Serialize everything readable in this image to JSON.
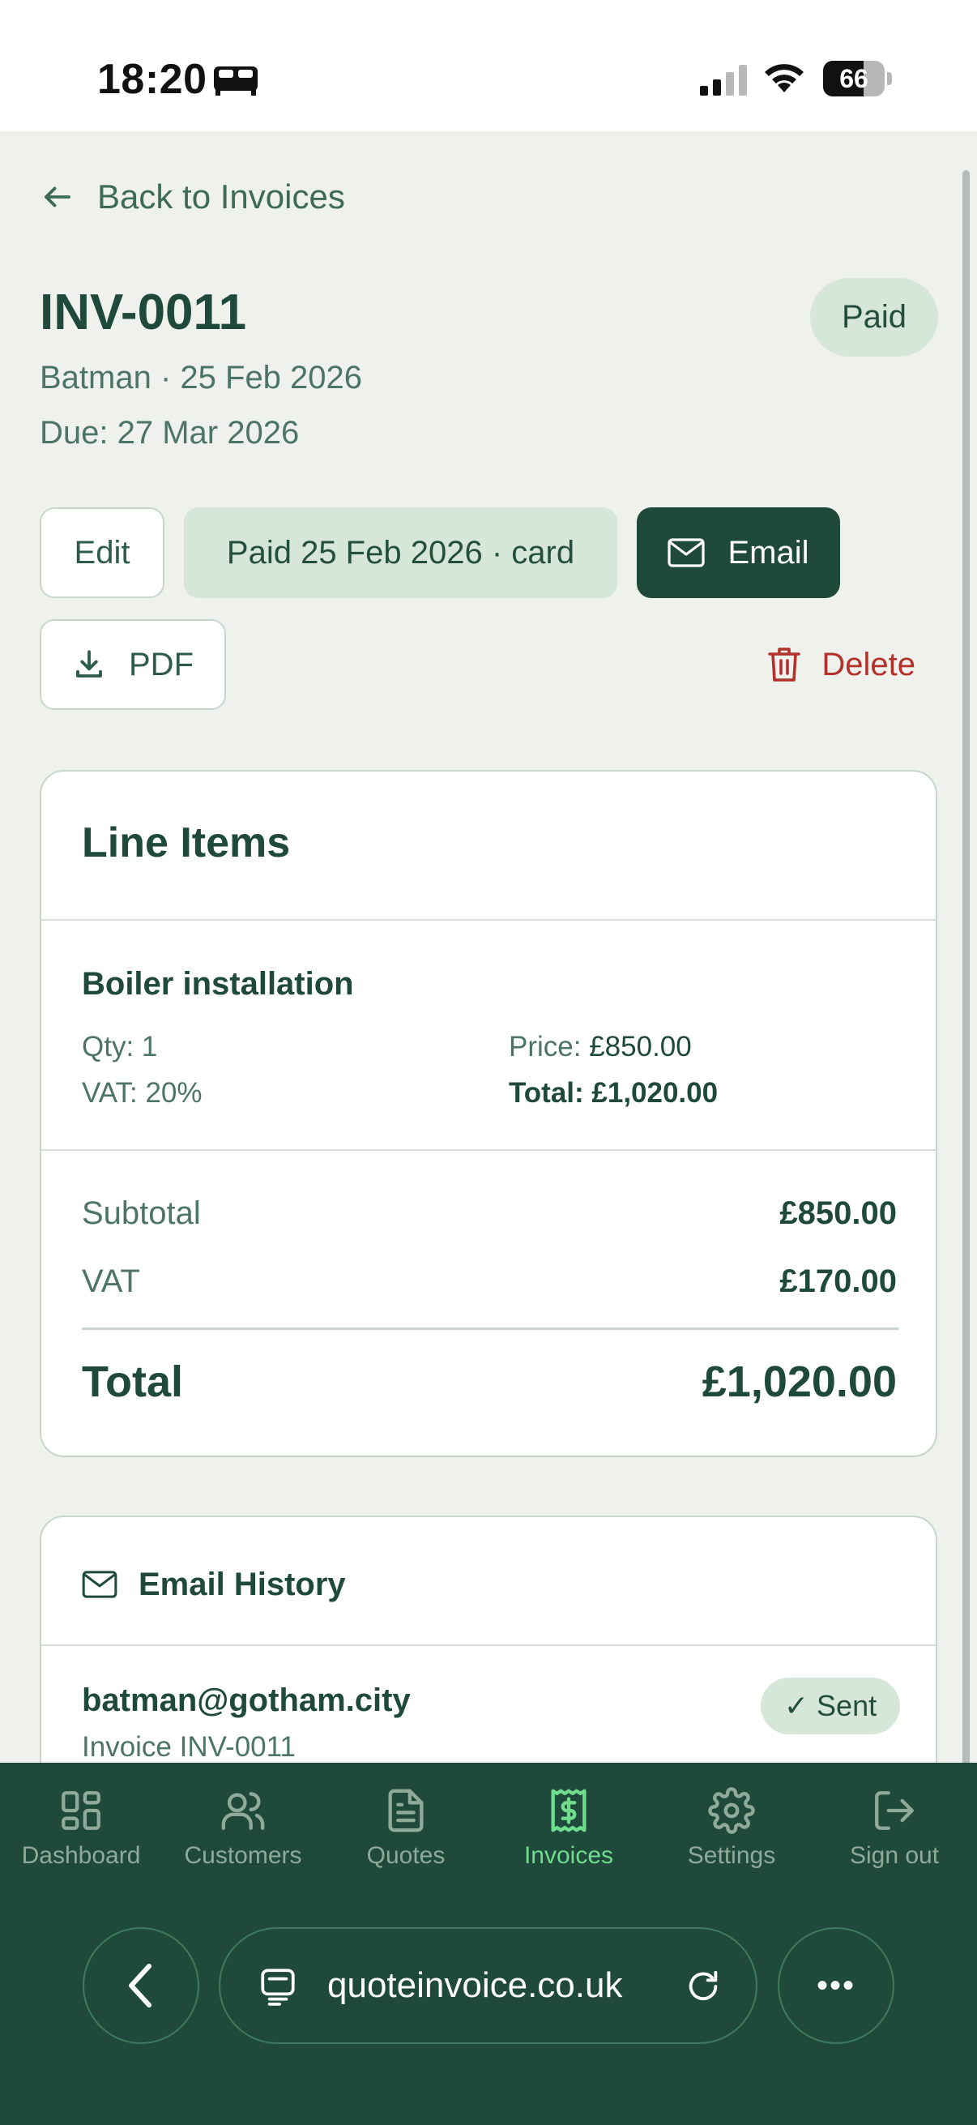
{
  "status_bar": {
    "time": "18:20",
    "battery_level": 66,
    "battery_label": "66"
  },
  "nav": {
    "back_label": "Back to Invoices"
  },
  "invoice": {
    "number": "INV-0011",
    "status": "Paid",
    "customer_date": "Batman · 25 Feb 2026",
    "due": "Due: 27 Mar 2026"
  },
  "actions": {
    "edit": "Edit",
    "paid_chip": "Paid 25 Feb 2026 · card",
    "email": "Email",
    "pdf": "PDF",
    "delete": "Delete"
  },
  "line_items": {
    "title": "Line Items",
    "items": [
      {
        "name": "Boiler installation",
        "qty": "Qty: 1",
        "vat": "VAT: 20%",
        "price_label": "Price:",
        "price": "£850.00",
        "total": "Total: £1,020.00"
      }
    ],
    "subtotal_label": "Subtotal",
    "subtotal": "£850.00",
    "vat_label": "VAT",
    "vat": "£170.00",
    "total_label": "Total",
    "total": "£1,020.00"
  },
  "email_history": {
    "title": "Email History",
    "entries": [
      {
        "email": "batman@gotham.city",
        "subject": "Invoice INV-0011",
        "status": "✓ Sent"
      }
    ]
  },
  "tabbar": {
    "tabs": [
      {
        "label": "Dashboard",
        "icon": "dashboard-icon"
      },
      {
        "label": "Customers",
        "icon": "customers-icon"
      },
      {
        "label": "Quotes",
        "icon": "quotes-icon"
      },
      {
        "label": "Invoices",
        "icon": "invoices-icon",
        "active": true
      },
      {
        "label": "Settings",
        "icon": "settings-icon"
      },
      {
        "label": "Sign out",
        "icon": "sign-out-icon"
      }
    ]
  },
  "browser": {
    "url": "quoteinvoice.co.uk",
    "more": "•••"
  },
  "colors": {
    "brand_dark": "#1f4a3b",
    "active_tab": "#6fdc8e",
    "danger": "#b3302b",
    "pill_bg": "#d6e6d8"
  }
}
